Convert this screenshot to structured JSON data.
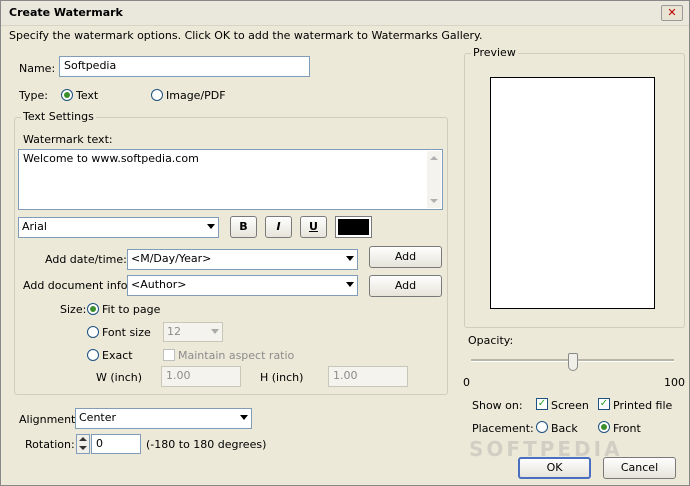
{
  "window": {
    "title": "Create Watermark",
    "close_glyph": "✕"
  },
  "instructions": "Specify the watermark options. Click OK to add the watermark to Watermarks Gallery.",
  "name": {
    "label": "Name:",
    "value": "Softpedia"
  },
  "type": {
    "label": "Type:",
    "text_option": "Text",
    "image_option": "Image/PDF",
    "selected": "Text"
  },
  "text_settings": {
    "group_title": "Text Settings",
    "watermark_text_label": "Watermark text:",
    "watermark_text_value": "Welcome to www.softpedia.com",
    "font": "Arial",
    "bold_label": "B",
    "italic_label": "I",
    "underline_label": "U",
    "color": "#000000",
    "date_label": "Add date/time:",
    "date_value": "<M/Day/Year>",
    "date_add": "Add",
    "docinfo_label": "Add document info:",
    "docinfo_value": "<Author>",
    "docinfo_add": "Add",
    "size_label": "Size:",
    "fit_to_page": "Fit to page",
    "font_size_label": "Font size",
    "font_size_value": "12",
    "exact_label": "Exact",
    "maintain_aspect": "Maintain aspect ratio",
    "w_label": "W (inch)",
    "w_value": "1.00",
    "h_label": "H (inch)",
    "h_value": "1.00"
  },
  "alignment": {
    "label": "Alignment:",
    "value": "Center"
  },
  "rotation": {
    "label": "Rotation:",
    "value": "0",
    "hint": "(-180 to 180 degrees)"
  },
  "preview": {
    "group_title": "Preview"
  },
  "opacity": {
    "label": "Opacity:",
    "min": "0",
    "max": "100",
    "value": 0.5
  },
  "show_on": {
    "label": "Show on:",
    "screen": "Screen",
    "printed": "Printed file",
    "screen_checked": true,
    "printed_checked": true
  },
  "placement": {
    "label": "Placement:",
    "back": "Back",
    "front": "Front",
    "selected": "Front"
  },
  "buttons": {
    "ok": "OK",
    "cancel": "Cancel"
  },
  "watermark_overlay": "SOFTPEDIA"
}
